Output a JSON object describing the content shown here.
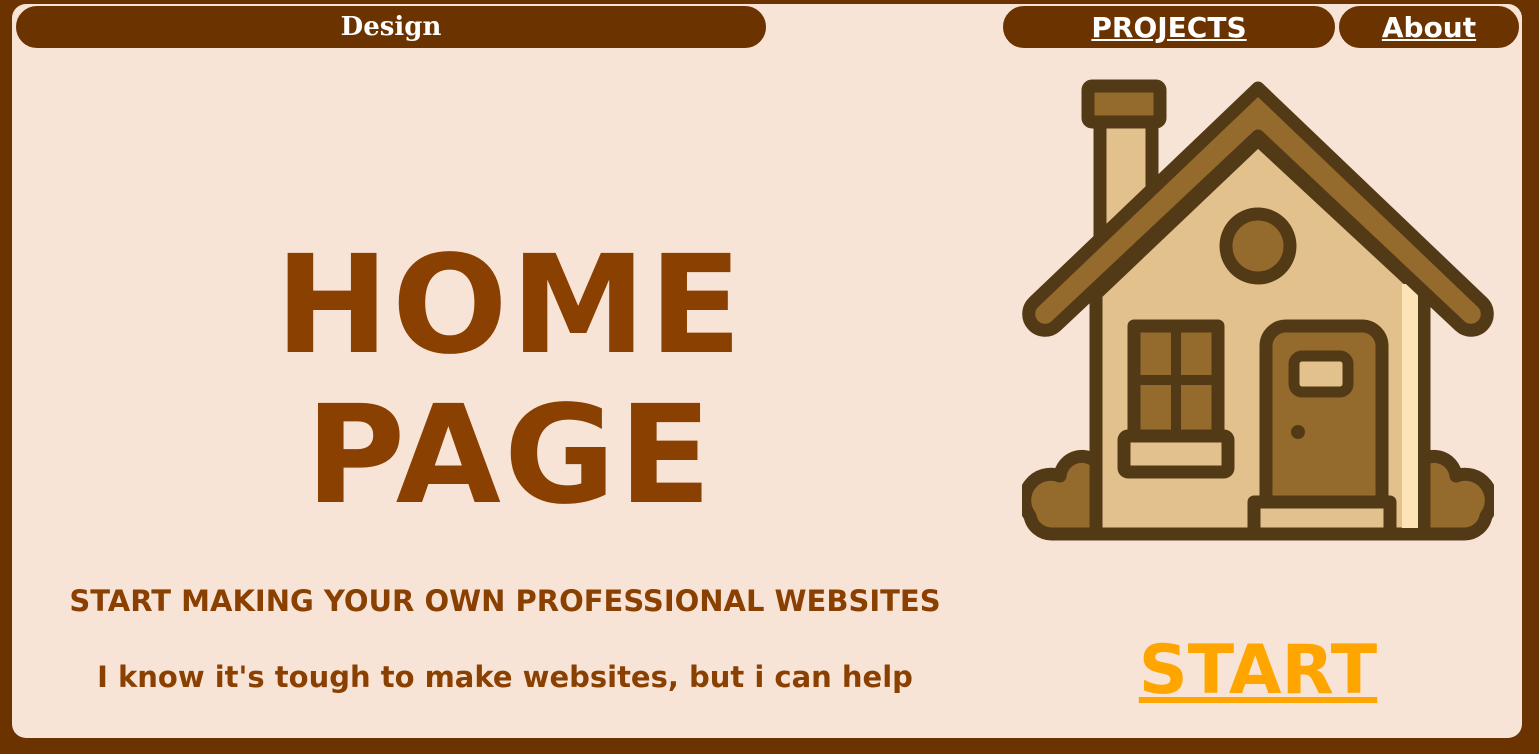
{
  "header": {
    "brand": "Design",
    "nav": [
      {
        "label": "PROJECTS"
      },
      {
        "label": "About"
      }
    ]
  },
  "hero": {
    "title": "HOME PAGE",
    "tagline": "START MAKING YOUR OWN PROFESSIONAL WEBSITES",
    "subtext": "I know it's tough to make websites, but i can help",
    "cta_label": "START",
    "illustration": "house-icon"
  },
  "colors": {
    "page_border": "#6b3300",
    "background": "#f8e4d6",
    "heading": "#8a4000",
    "cta": "#ffa500",
    "nav_text": "#ffffff"
  }
}
